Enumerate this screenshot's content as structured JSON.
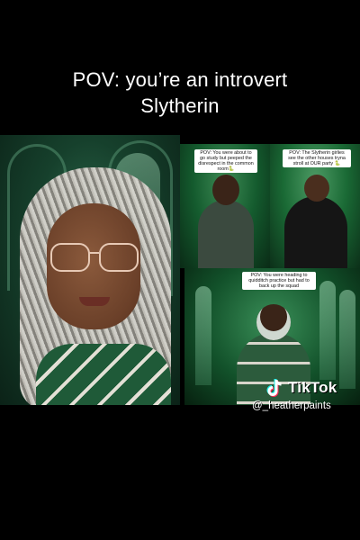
{
  "caption": {
    "line1": "POV: you’re an introvert",
    "line2": "Slytherin"
  },
  "panels": {
    "top_middle_caption": "POV: You were about to go study but peeped the disrespect in the common room🐍",
    "top_right_caption": "POV: The Slytherin girlies see the other houses tryna stroll at OUR party 🐍",
    "bottom_caption": "POV: You were heading to quidditch practice but had to back up the squad"
  },
  "watermark": {
    "brand": "TikTok",
    "handle": "@_heatherpaints",
    "icon": "tiktok-note-icon"
  },
  "colors": {
    "background": "#000000",
    "slytherin_green": "#1f5a38",
    "text": "#ffffff"
  }
}
